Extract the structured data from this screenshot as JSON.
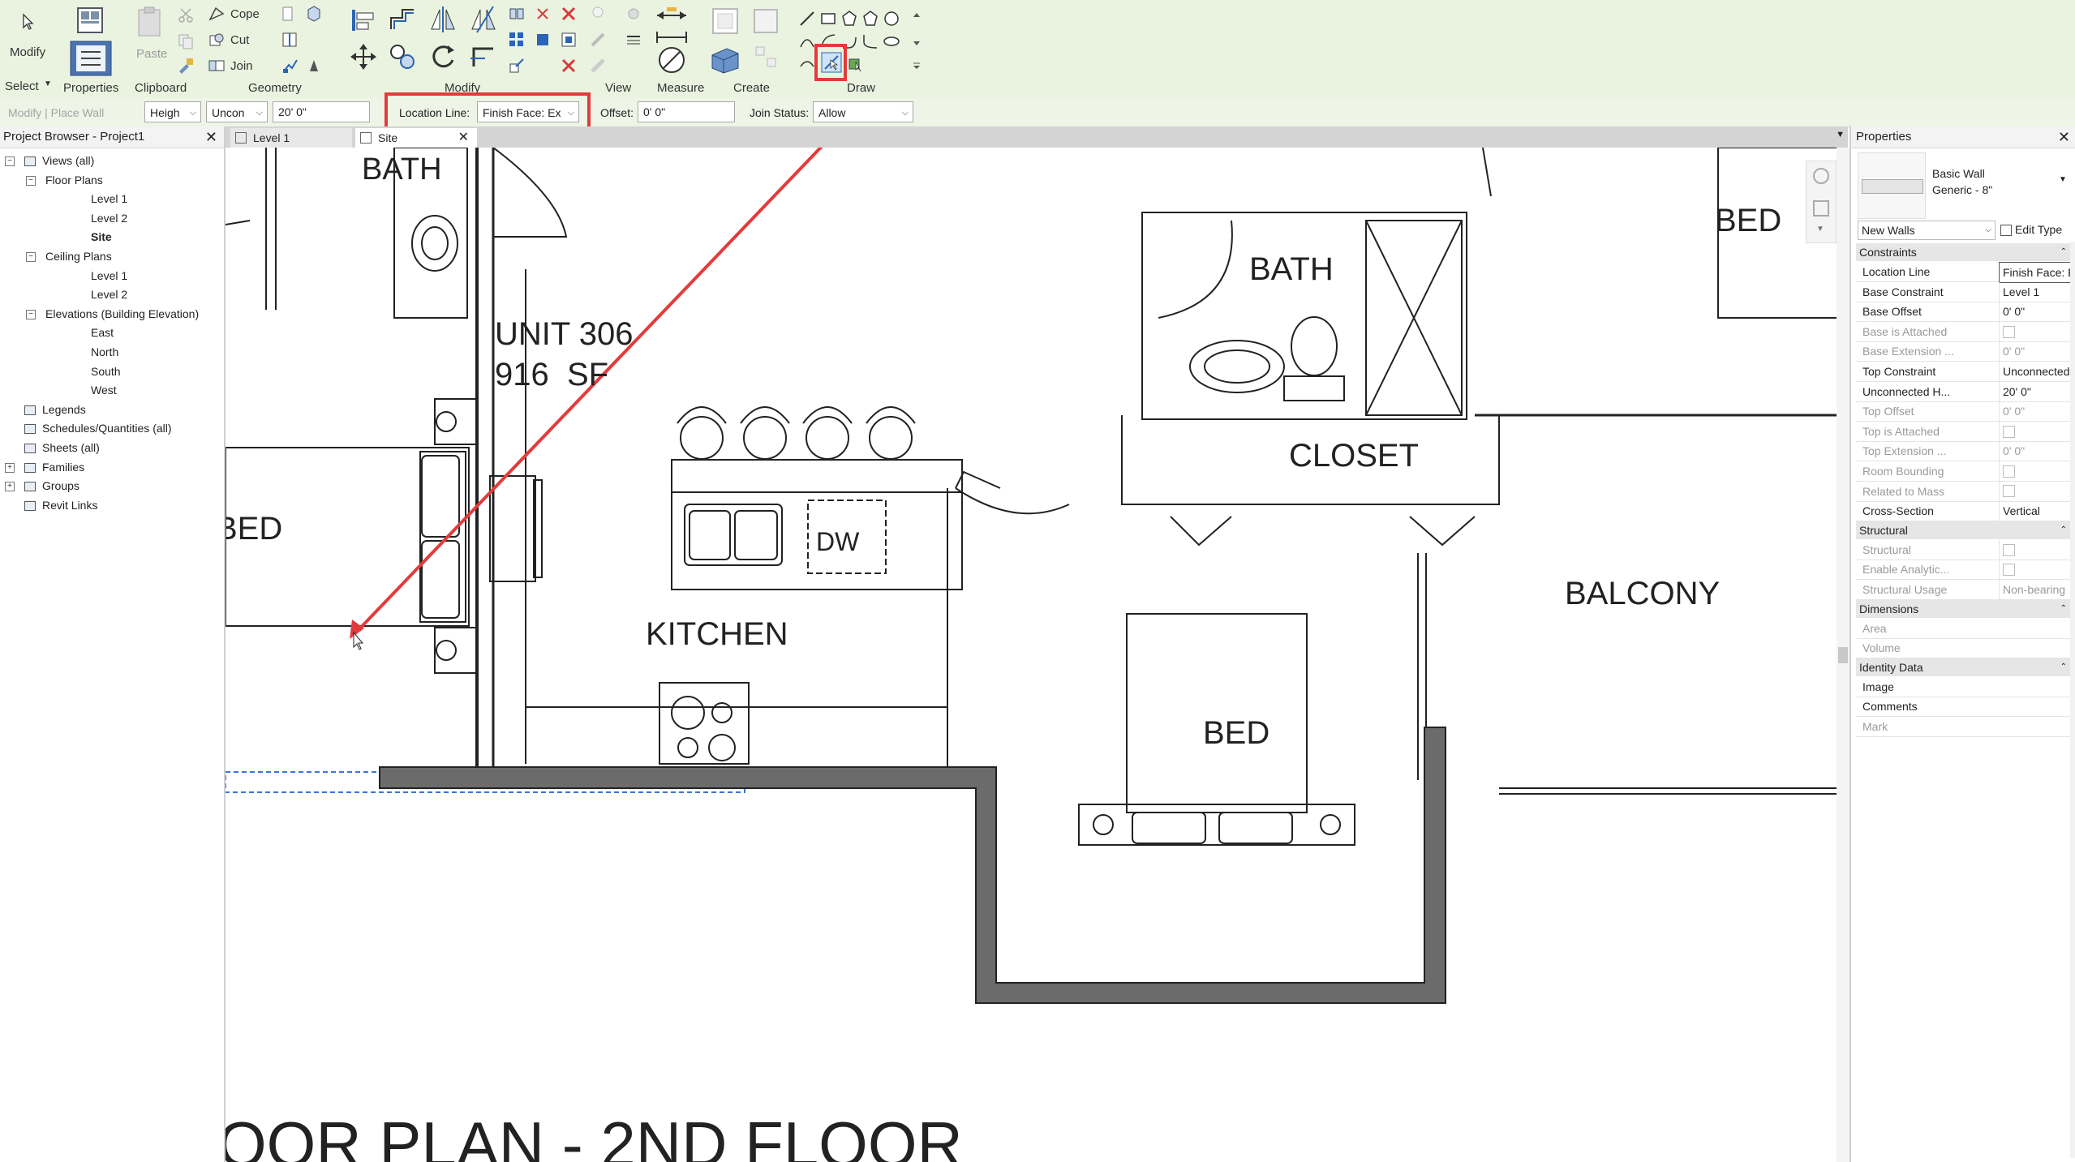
{
  "ribbon": {
    "modify_label": "Modify",
    "select_label": "Select",
    "properties_label": "Properties",
    "paste_label": "Paste",
    "clipboard_label": "Clipboard",
    "cope_label": "Cope",
    "cut_label": "Cut",
    "join_label": "Join",
    "geometry_label": "Geometry",
    "modify_panel_label": "Modify",
    "view_label": "View",
    "measure_label": "Measure",
    "create_label": "Create",
    "draw_label": "Draw"
  },
  "options_bar": {
    "context_label": "Modify | Place Wall",
    "height_mode": "Heigh",
    "constraint": "Uncon",
    "height_value": "20'  0\"",
    "location_line_label": "Location Line:",
    "location_line_value": "Finish Face: Ex",
    "offset_label": "Offset:",
    "offset_value": "0'  0\"",
    "join_status_label": "Join Status:",
    "join_status_value": "Allow"
  },
  "browser": {
    "title": "Project Browser - Project1",
    "items": [
      {
        "label": "Views (all)"
      },
      {
        "label": "Floor Plans"
      },
      {
        "label": "Level 1"
      },
      {
        "label": "Level 2"
      },
      {
        "label": "Site"
      },
      {
        "label": "Ceiling Plans"
      },
      {
        "label": "Level 1"
      },
      {
        "label": "Level 2"
      },
      {
        "label": "Elevations (Building Elevation)"
      },
      {
        "label": "East"
      },
      {
        "label": "North"
      },
      {
        "label": "South"
      },
      {
        "label": "West"
      },
      {
        "label": "Legends"
      },
      {
        "label": "Schedules/Quantities (all)"
      },
      {
        "label": "Sheets (all)"
      },
      {
        "label": "Families"
      },
      {
        "label": "Groups"
      },
      {
        "label": "Revit Links"
      }
    ]
  },
  "tabs": [
    {
      "label": "Level 1"
    },
    {
      "label": "Site"
    }
  ],
  "plan": {
    "bath_left": "BATH",
    "unit_name": "UNIT 306",
    "unit_area": "916  SF",
    "bed_left": "BED",
    "dw": "DW",
    "kitchen": "KITCHEN",
    "bath_right": "BATH",
    "closet": "CLOSET",
    "bed_top_right": "BED",
    "balcony": "BALCONY",
    "bed_center": "BED",
    "sheet_title": "OOR PLAN - 2ND FLOOR"
  },
  "properties": {
    "title": "Properties",
    "type_family": "Basic Wall",
    "type_name": "Generic - 8\"",
    "instance_filter": "New Walls",
    "edit_type_label": "Edit Type",
    "sections": [
      {
        "name": "Constraints",
        "rows": [
          {
            "key": "Location Line",
            "value": "Finish Face: Exte",
            "enabled": true
          },
          {
            "key": "Base Constraint",
            "value": "Level 1",
            "enabled": true
          },
          {
            "key": "Base Offset",
            "value": "0'  0\"",
            "enabled": true
          },
          {
            "key": "Base is Attached",
            "value": "",
            "enabled": false
          },
          {
            "key": "Base Extension ...",
            "value": "0'  0\"",
            "enabled": false
          },
          {
            "key": "Top Constraint",
            "value": "Unconnected",
            "enabled": true
          },
          {
            "key": "Unconnected H...",
            "value": "20'  0\"",
            "enabled": true
          },
          {
            "key": "Top Offset",
            "value": "0'  0\"",
            "enabled": false
          },
          {
            "key": "Top is Attached",
            "value": "",
            "enabled": false
          },
          {
            "key": "Top Extension ...",
            "value": "0'  0\"",
            "enabled": false
          },
          {
            "key": "Room Bounding",
            "value": "",
            "enabled": false
          },
          {
            "key": "Related to Mass",
            "value": "",
            "enabled": false
          },
          {
            "key": "Cross-Section",
            "value": "Vertical",
            "enabled": true
          }
        ]
      },
      {
        "name": "Structural",
        "rows": [
          {
            "key": "Structural",
            "value": "",
            "enabled": false
          },
          {
            "key": "Enable Analytic...",
            "value": "",
            "enabled": false
          },
          {
            "key": "Structural Usage",
            "value": "Non-bearing",
            "enabled": false
          }
        ]
      },
      {
        "name": "Dimensions",
        "rows": [
          {
            "key": "Area",
            "value": "",
            "enabled": false
          },
          {
            "key": "Volume",
            "value": "",
            "enabled": false
          }
        ]
      },
      {
        "name": "Identity Data",
        "rows": [
          {
            "key": "Image",
            "value": "",
            "enabled": true
          },
          {
            "key": "Comments",
            "value": "",
            "enabled": true
          },
          {
            "key": "Mark",
            "value": "",
            "enabled": false
          }
        ]
      }
    ]
  },
  "colors": {
    "ribbon_bg": "#eaf3df",
    "highlight_red": "#e33b3b",
    "wall_fill": "#6b6b6b"
  }
}
